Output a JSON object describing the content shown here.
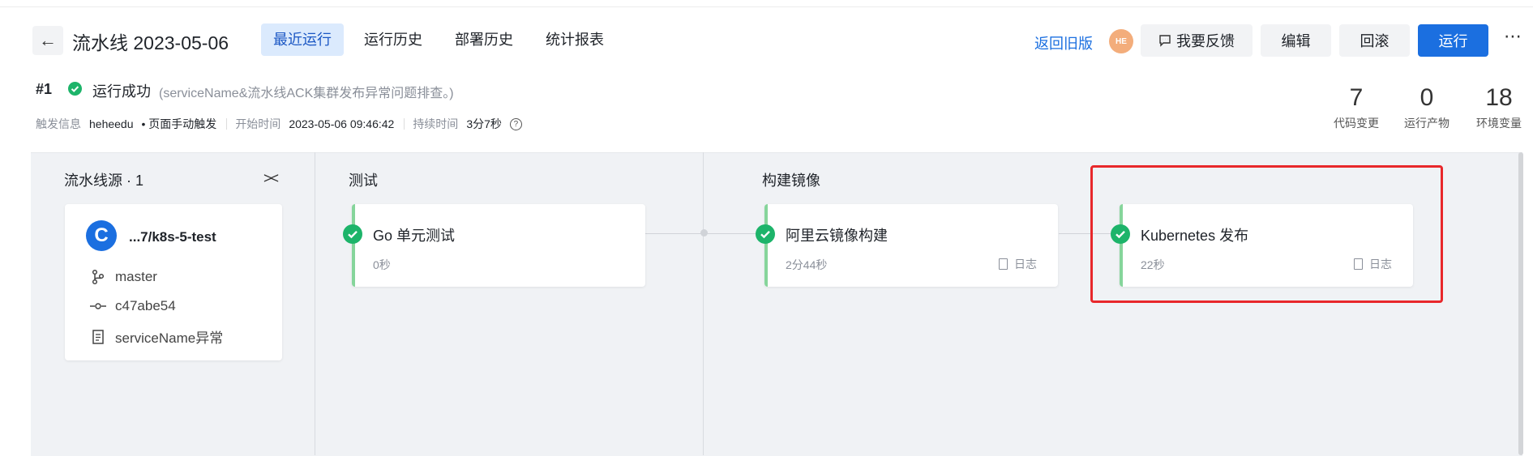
{
  "header": {
    "title": "流水线 2023-05-06",
    "tabs": [
      {
        "label": "最近运行",
        "active": true
      },
      {
        "label": "运行历史",
        "active": false
      },
      {
        "label": "部署历史",
        "active": false
      },
      {
        "label": "统计报表",
        "active": false
      }
    ],
    "back_old_label": "返回旧版",
    "avatar_text": "HE",
    "feedback_label": "我要反馈",
    "edit_label": "编辑",
    "rollback_label": "回滚",
    "run_label": "运行",
    "more_label": "⋯"
  },
  "run": {
    "number": "#1",
    "status": "运行成功",
    "description": "(serviceName&流水线ACK集群发布异常问题排查。)",
    "trigger_key": "触发信息",
    "trigger_user": "heheedu",
    "trigger_mode": "• 页面手动触发",
    "start_key": "开始时间",
    "start_value": "2023-05-06 09:46:42",
    "duration_key": "持续时间",
    "duration_value": "3分7秒"
  },
  "stats": [
    {
      "value": "7",
      "label": "代码变更"
    },
    {
      "value": "0",
      "label": "运行产物"
    },
    {
      "value": "18",
      "label": "环境变量"
    }
  ],
  "source": {
    "stage_title": "流水线源 · 1",
    "collapse_icon": "><",
    "repo_logo": "C",
    "repo_name": "...7/k8s-5-test",
    "branch": "master",
    "commit": "c47abe54",
    "message": "serviceName异常"
  },
  "stages": [
    {
      "title": "测试",
      "jobs": [
        {
          "name": "Go 单元测试",
          "duration": "0秒",
          "log_label": ""
        }
      ]
    },
    {
      "title": "构建镜像",
      "jobs": [
        {
          "name": "阿里云镜像构建",
          "duration": "2分44秒",
          "log_label": "日志"
        },
        {
          "name": "Kubernetes 发布",
          "duration": "22秒",
          "log_label": "日志"
        }
      ]
    }
  ],
  "colors": {
    "primary": "#1b6fe0",
    "success": "#1db46a",
    "highlight": "#e8282b",
    "tab_active_bg": "#dbeafd"
  }
}
